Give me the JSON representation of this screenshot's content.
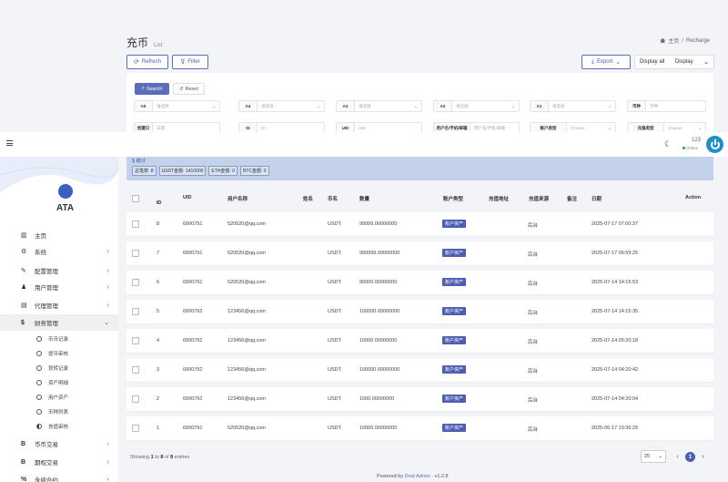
{
  "page": {
    "title": "充币",
    "subtitle": "List"
  },
  "breadcrumb": {
    "home": "主页",
    "sep": "/",
    "current": "Recharge"
  },
  "toolbar": {
    "refresh": "Refresh",
    "filter": "Filter",
    "export": "Export",
    "display_all": "Display all",
    "display": "Display"
  },
  "filters": {
    "search": "Search",
    "reset": "Reset",
    "row1": [
      {
        "label": "A5",
        "placeholder": "请选择"
      },
      {
        "label": "A4",
        "placeholder": "请选择"
      },
      {
        "label": "A3",
        "placeholder": "请选择"
      },
      {
        "label": "A2",
        "placeholder": "请选择"
      },
      {
        "label": "A1",
        "placeholder": "请选择"
      },
      {
        "label": "币种",
        "placeholder": "币种"
      }
    ],
    "row2": [
      {
        "label": "创建日",
        "placeholder": "日期"
      },
      {
        "label": "ID",
        "placeholder": "ID"
      },
      {
        "label": "UID",
        "placeholder": "UID"
      },
      {
        "label": "用户名/手机/邮箱",
        "placeholder": "用户名/手机/邮箱"
      },
      {
        "label": "账户类型",
        "placeholder": "Choose"
      },
      {
        "label": "充值类型",
        "placeholder": "Choose"
      }
    ]
  },
  "header": {
    "user": "123",
    "status": "Online"
  },
  "sidebar": {
    "brand": "ATA",
    "items": [
      {
        "label": "主页",
        "icon": "dashboard-icon",
        "glyph": "▥"
      },
      {
        "label": "系统",
        "icon": "settings-icon",
        "glyph": "⚙"
      },
      {
        "label": "配置管理",
        "icon": "wrench-icon",
        "glyph": "✎"
      },
      {
        "label": "用户管理",
        "icon": "user-icon",
        "glyph": "♟"
      },
      {
        "label": "代理管理",
        "icon": "id-card-icon",
        "glyph": "▤"
      },
      {
        "label": "财务管理",
        "icon": "dollar-icon",
        "glyph": "$"
      }
    ],
    "subitems": [
      "币币记录",
      "提币审核",
      "划转记录",
      "资产明细",
      "用户资产",
      "币种列表",
      "充值审核"
    ],
    "bottom": [
      {
        "label": "币币交易",
        "icon": "bitcoin-icon",
        "glyph": "B"
      },
      {
        "label": "期权交易",
        "icon": "bitcoin-icon",
        "glyph": "B"
      },
      {
        "label": "永续合约",
        "icon": "link-icon",
        "glyph": "%"
      }
    ]
  },
  "summary": {
    "title": "$ 统计",
    "items": [
      "总笔数: 8",
      "USDT金额: 1410000",
      "ETH金额: 0",
      "BTC金额: 0"
    ]
  },
  "table": {
    "columns": [
      "ID",
      "UID",
      "用户名称",
      "姓名",
      "币名",
      "数量",
      "账户类型",
      "充值地址",
      "充值来源",
      "备注",
      "日期",
      "Action"
    ],
    "rows": [
      {
        "id": "8",
        "uid": "6000791",
        "user": "520520@qq.com",
        "coin": "USDT",
        "amount": "99999.00000000",
        "type": "账户资产",
        "source": "后台",
        "date": "2025-07-17 07:00:37"
      },
      {
        "id": "7",
        "uid": "6000791",
        "user": "520520@qq.com",
        "coin": "USDT",
        "amount": "999999.00000000",
        "type": "账户资产",
        "source": "后台",
        "date": "2025-07-17 06:59:25"
      },
      {
        "id": "6",
        "uid": "6000791",
        "user": "520520@qq.com",
        "coin": "USDT",
        "amount": "90000.00000000",
        "type": "账户资产",
        "source": "后台",
        "date": "2025-07-14 14:15:53"
      },
      {
        "id": "5",
        "uid": "6000792",
        "user": "123456@qq.com",
        "coin": "USDT",
        "amount": "100000.00000000",
        "type": "账户资产",
        "source": "后台",
        "date": "2025-07-14 14:15:35"
      },
      {
        "id": "4",
        "uid": "6000792",
        "user": "123456@qq.com",
        "coin": "USDT",
        "amount": "10000.00000000",
        "type": "账户资产",
        "source": "后台",
        "date": "2025-07-14 05:20:18"
      },
      {
        "id": "3",
        "uid": "6000792",
        "user": "123456@qq.com",
        "coin": "USDT",
        "amount": "100000.00000000",
        "type": "账户资产",
        "source": "后台",
        "date": "2025-07-14 04:20:42"
      },
      {
        "id": "2",
        "uid": "6000792",
        "user": "123456@qq.com",
        "coin": "USDT",
        "amount": "1000.00000000",
        "type": "账户资产",
        "source": "后台",
        "date": "2025-07-14 04:20:04"
      },
      {
        "id": "1",
        "uid": "6000791",
        "user": "520520@qq.com",
        "coin": "USDT",
        "amount": "10000.00000000",
        "type": "账户资产",
        "source": "后台",
        "date": "2025-06-17 19:36:29"
      }
    ]
  },
  "pagination": {
    "showing_prefix": "Showing",
    "from": "1",
    "to_word": "to",
    "to": "8",
    "of_word": "of",
    "total": "8",
    "suffix": "entries",
    "page_size": "25",
    "current": "1"
  },
  "footer": {
    "prefix": "Powered by",
    "link": "Dcat Admin",
    "version": "· v1.2.8"
  }
}
